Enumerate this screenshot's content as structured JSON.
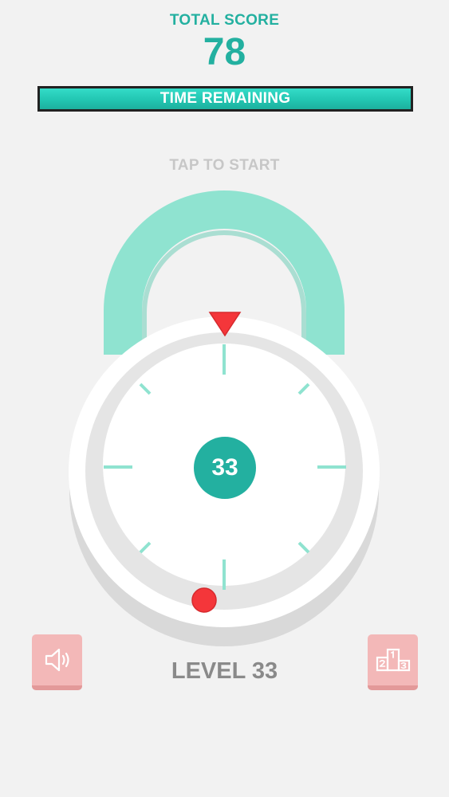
{
  "header": {
    "score_label": "TOTAL SCORE",
    "score_value": "78"
  },
  "timer": {
    "label": "TIME REMAINING",
    "fraction_remaining": 1.0
  },
  "prompt": {
    "tap_to_start": "TAP TO START"
  },
  "lock": {
    "center_number": "33",
    "tick_count": 8
  },
  "footer": {
    "level_label": "LEVEL 33"
  },
  "icons": {
    "sound": "speaker-icon",
    "leaderboard": "podium-icon"
  },
  "colors": {
    "accent": "#23b0a0",
    "shackle": "#8fe3d0",
    "marker": "#f4363a",
    "button": "#f3b8b8"
  }
}
